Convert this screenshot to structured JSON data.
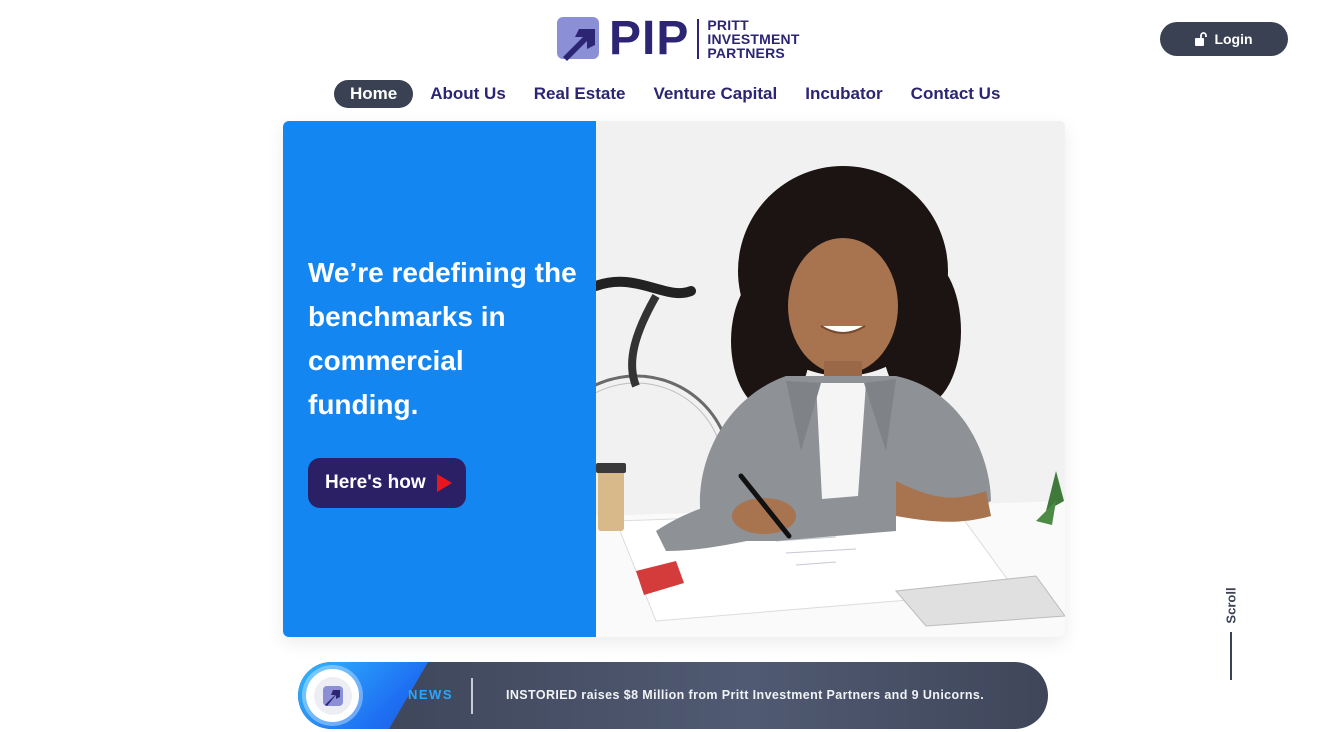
{
  "brand": {
    "logo_text": "PIP",
    "sub_lines": [
      "PRITT",
      "INVESTMENT",
      "PARTNERS"
    ],
    "colors": {
      "navy": "#2b2574",
      "mark": "#8b8fd6"
    }
  },
  "header": {
    "login_label": "Login",
    "login_icon": "lock-icon"
  },
  "nav": {
    "items": [
      {
        "label": "Home",
        "active": true
      },
      {
        "label": "About Us"
      },
      {
        "label": "Real Estate"
      },
      {
        "label": "Venture Capital"
      },
      {
        "label": "Incubator"
      },
      {
        "label": "Contact Us"
      }
    ]
  },
  "hero": {
    "title": "We’re redefining the benchmarks in commercial funding.",
    "cta_label": "Here's how",
    "cta_icon": "play-icon",
    "image_desc_icon": "photo-woman-drafting",
    "accent": "#1386f2",
    "cta_bg": "#2b2066",
    "play_color": "#e8161e"
  },
  "news": {
    "label": "NEWS",
    "text": "INSTORIED raises $8 Million from Pritt Investment Partners and 9 Unicorns.",
    "icon": "arrow-up-right-icon"
  },
  "scroll": {
    "label": "Scroll"
  }
}
